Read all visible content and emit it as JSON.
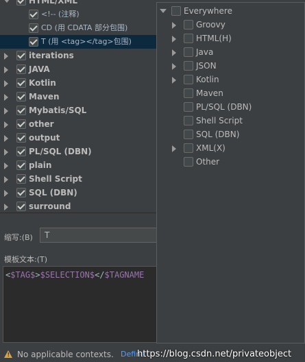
{
  "tree": {
    "items": [
      {
        "label": "HTML/XML",
        "bold": true,
        "expanded": true,
        "checked": true
      },
      {
        "label": "<!-- (注释)",
        "checked": true,
        "child": true
      },
      {
        "label": "CD (用 CDATA 部分包围)",
        "checked": true,
        "child": true
      },
      {
        "label": "T (用 <tag></tag>包围)",
        "checked": true,
        "child": true,
        "selected": true
      },
      {
        "label": "iterations",
        "bold": true,
        "checked": true
      },
      {
        "label": "JAVA",
        "bold": true,
        "checked": true
      },
      {
        "label": "Kotlin",
        "bold": true,
        "checked": true
      },
      {
        "label": "Maven",
        "bold": true,
        "checked": true
      },
      {
        "label": "Mybatis/SQL",
        "bold": true,
        "checked": true
      },
      {
        "label": "other",
        "bold": true,
        "checked": true
      },
      {
        "label": "output",
        "bold": true,
        "checked": true
      },
      {
        "label": "PL/SQL (DBN)",
        "bold": true,
        "checked": true
      },
      {
        "label": "plain",
        "bold": true,
        "checked": true
      },
      {
        "label": "Shell Script",
        "bold": true,
        "checked": true
      },
      {
        "label": "SQL (DBN)",
        "bold": true,
        "checked": true
      },
      {
        "label": "surround",
        "bold": true,
        "checked": true
      }
    ]
  },
  "form": {
    "abbreviation_label": "缩写:(B)",
    "abbreviation_value": "T",
    "template_text_label": "模板文本:(T)",
    "template_tokens": [
      {
        "text": "<",
        "kind": "txt"
      },
      {
        "text": "$TAG$",
        "kind": "var"
      },
      {
        "text": ">",
        "kind": "txt"
      },
      {
        "text": "$SELECTION$",
        "kind": "var"
      },
      {
        "text": "</",
        "kind": "txt"
      },
      {
        "text": "$TAGNAME",
        "kind": "var"
      }
    ]
  },
  "status": {
    "message": "No applicable contexts.",
    "define_link": "Define",
    "watermark": "https://blog.csdn.net/privateobject"
  },
  "contexts_popup": {
    "items": [
      {
        "label": "Everywhere",
        "expanded": true,
        "level": 0
      },
      {
        "label": "Groovy",
        "has_children": true,
        "level": 1
      },
      {
        "label": "HTML(H)",
        "has_children": true,
        "level": 1
      },
      {
        "label": "Java",
        "has_children": true,
        "level": 1
      },
      {
        "label": "JSON",
        "has_children": true,
        "level": 1
      },
      {
        "label": "Kotlin",
        "has_children": true,
        "level": 1
      },
      {
        "label": "Maven",
        "has_children": false,
        "level": 1
      },
      {
        "label": "PL/SQL (DBN)",
        "has_children": false,
        "level": 1
      },
      {
        "label": "Shell Script",
        "has_children": false,
        "level": 1
      },
      {
        "label": "SQL (DBN)",
        "has_children": false,
        "level": 1
      },
      {
        "label": "XML(X)",
        "has_children": true,
        "level": 1
      },
      {
        "label": "Other",
        "has_children": false,
        "level": 1
      }
    ]
  },
  "colors": {
    "background": "#3c3f41",
    "selection": "#0d293e",
    "link": "#589df6",
    "template_variable": "#9876aa",
    "warning": "#d9a343"
  }
}
